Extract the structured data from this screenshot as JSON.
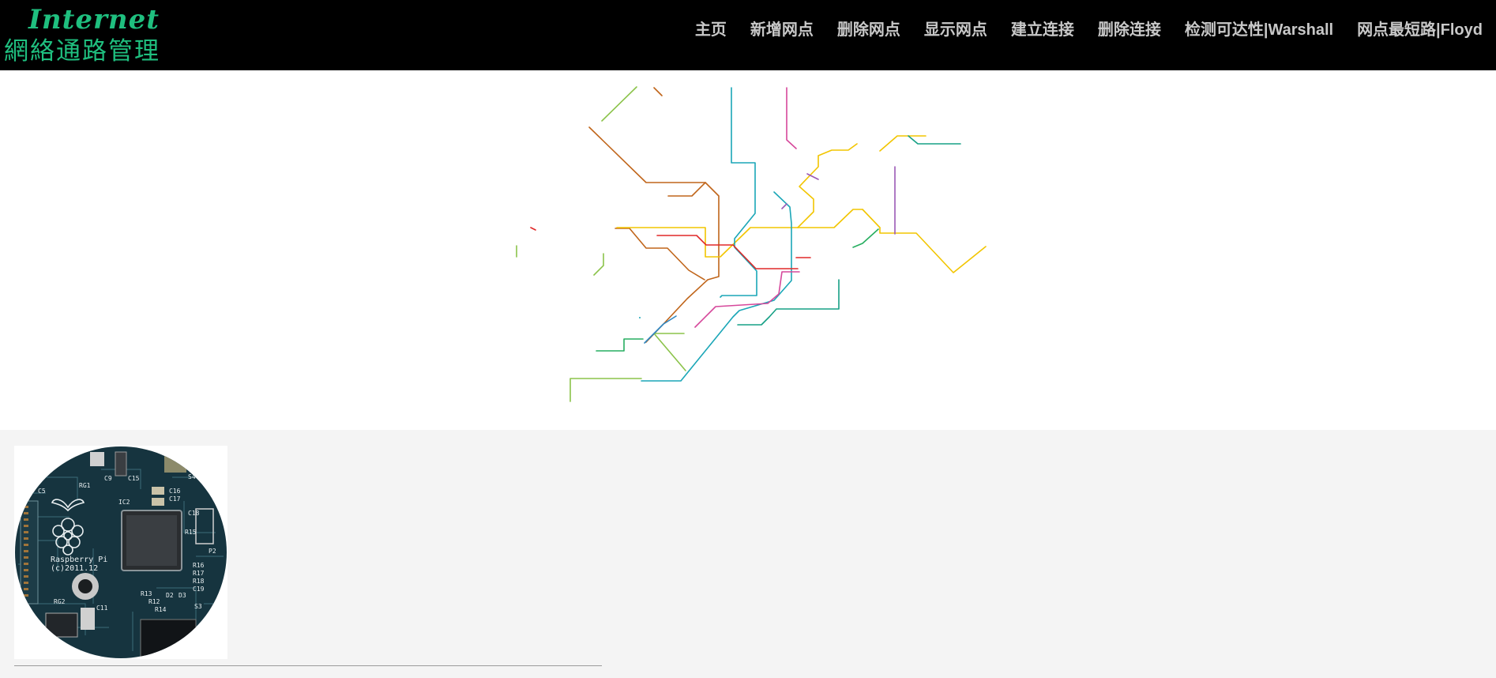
{
  "header": {
    "logo_title": "Internet",
    "logo_subtitle": "網絡通路管理",
    "brand_color": "#1fbf7f",
    "background": "#000000"
  },
  "nav": {
    "items": [
      {
        "label": "主页"
      },
      {
        "label": "新增网点"
      },
      {
        "label": "删除网点"
      },
      {
        "label": "显示网点"
      },
      {
        "label": "建立连接"
      },
      {
        "label": "删除连接"
      },
      {
        "label": "检测可达性|Warshall"
      },
      {
        "label": "网点最短路|Floyd"
      }
    ],
    "text_color": "#c8c8c8"
  },
  "network_map": {
    "line_colors": [
      "#c0651a",
      "#f2c500",
      "#1aa6b7",
      "#e02828",
      "#8bc34a",
      "#d6489b",
      "#9b59b6",
      "#2e86c1",
      "#27ae60",
      "#16a085"
    ]
  },
  "board_image": {
    "icon": "raspberry-pi-board-icon",
    "printed_text": [
      "Raspberry Pi",
      "(c)2011.12",
      "RG1",
      "RG2",
      "IC2",
      "C15",
      "C16",
      "C17",
      "C18",
      "R15",
      "P2",
      "S4",
      "S3",
      "D2",
      "D3",
      "C9",
      "C11",
      "C5",
      "R16",
      "R17",
      "R18",
      "C19",
      "R13",
      "R12",
      "R14"
    ]
  }
}
